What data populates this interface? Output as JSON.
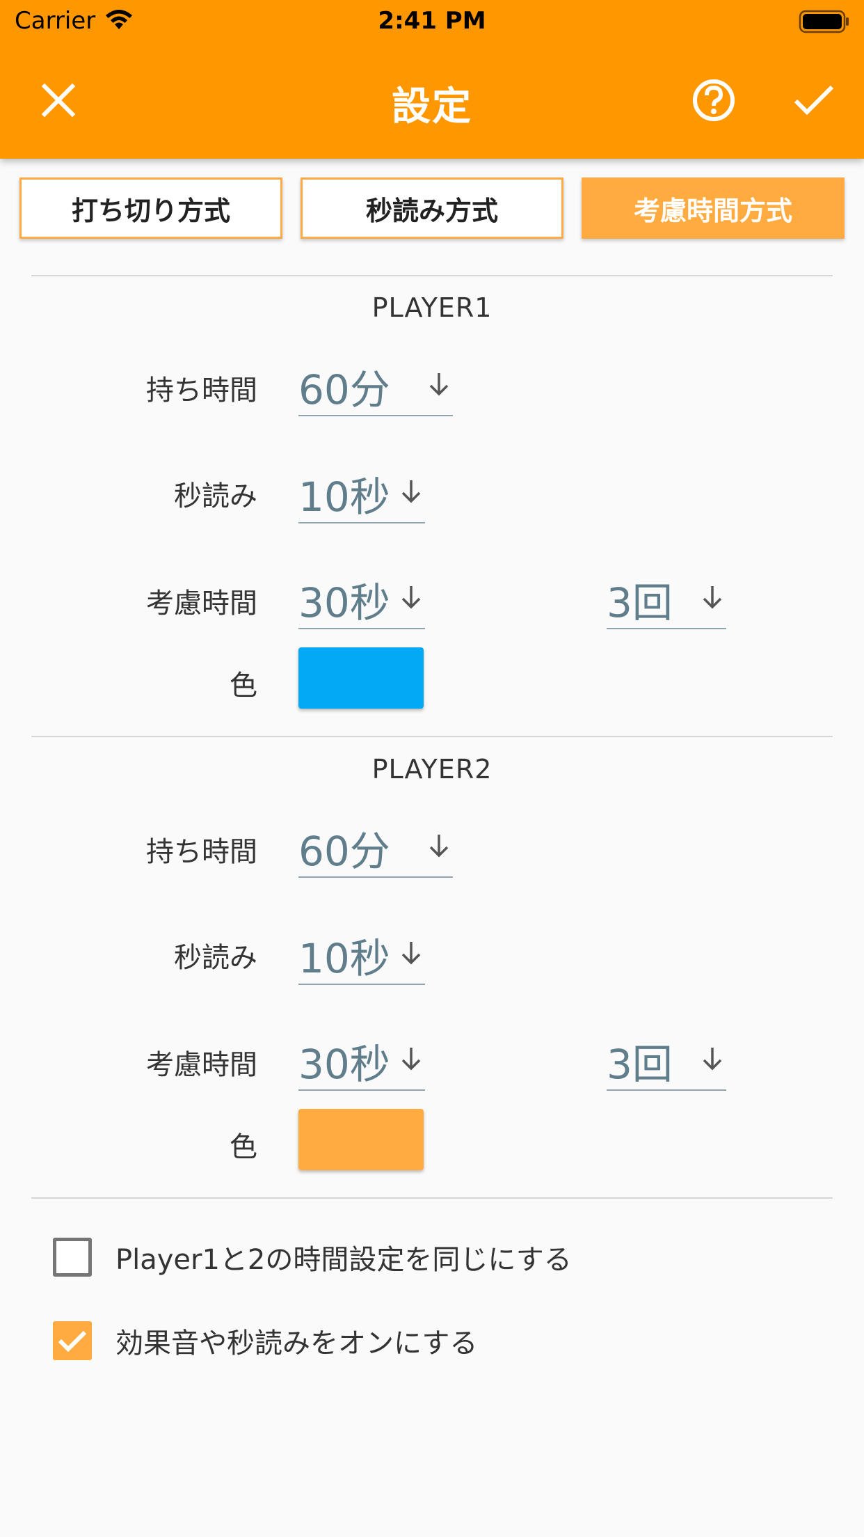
{
  "status_bar": {
    "carrier": "Carrier",
    "time": "2:41 PM"
  },
  "toolbar": {
    "title": "設定",
    "close_icon": "close-icon",
    "help_icon": "help-circle-icon",
    "confirm_icon": "check-icon"
  },
  "modes": [
    {
      "label": "打ち切り方式",
      "active": false
    },
    {
      "label": "秒読み方式",
      "active": false
    },
    {
      "label": "考慮時間方式",
      "active": true
    }
  ],
  "players": [
    {
      "title": "PLAYER1",
      "time_label": "持ち時間",
      "time_value": "60分",
      "byoyomi_label": "秒読み",
      "byoyomi_value": "10秒",
      "consider_label": "考慮時間",
      "consider_value": "30秒",
      "consider_count": "3回",
      "color_label": "色",
      "color": "#03a9f4"
    },
    {
      "title": "PLAYER2",
      "time_label": "持ち時間",
      "time_value": "60分",
      "byoyomi_label": "秒読み",
      "byoyomi_value": "10秒",
      "consider_label": "考慮時間",
      "consider_value": "30秒",
      "consider_count": "3回",
      "color_label": "色",
      "color": "#ffab40"
    }
  ],
  "options": [
    {
      "label": "Player1と2の時間設定を同じにする",
      "checked": false
    },
    {
      "label": "効果音や秒読みをオンにする",
      "checked": true
    }
  ],
  "colors": {
    "accent": "#ff9800",
    "accent_light": "#ffab40"
  }
}
